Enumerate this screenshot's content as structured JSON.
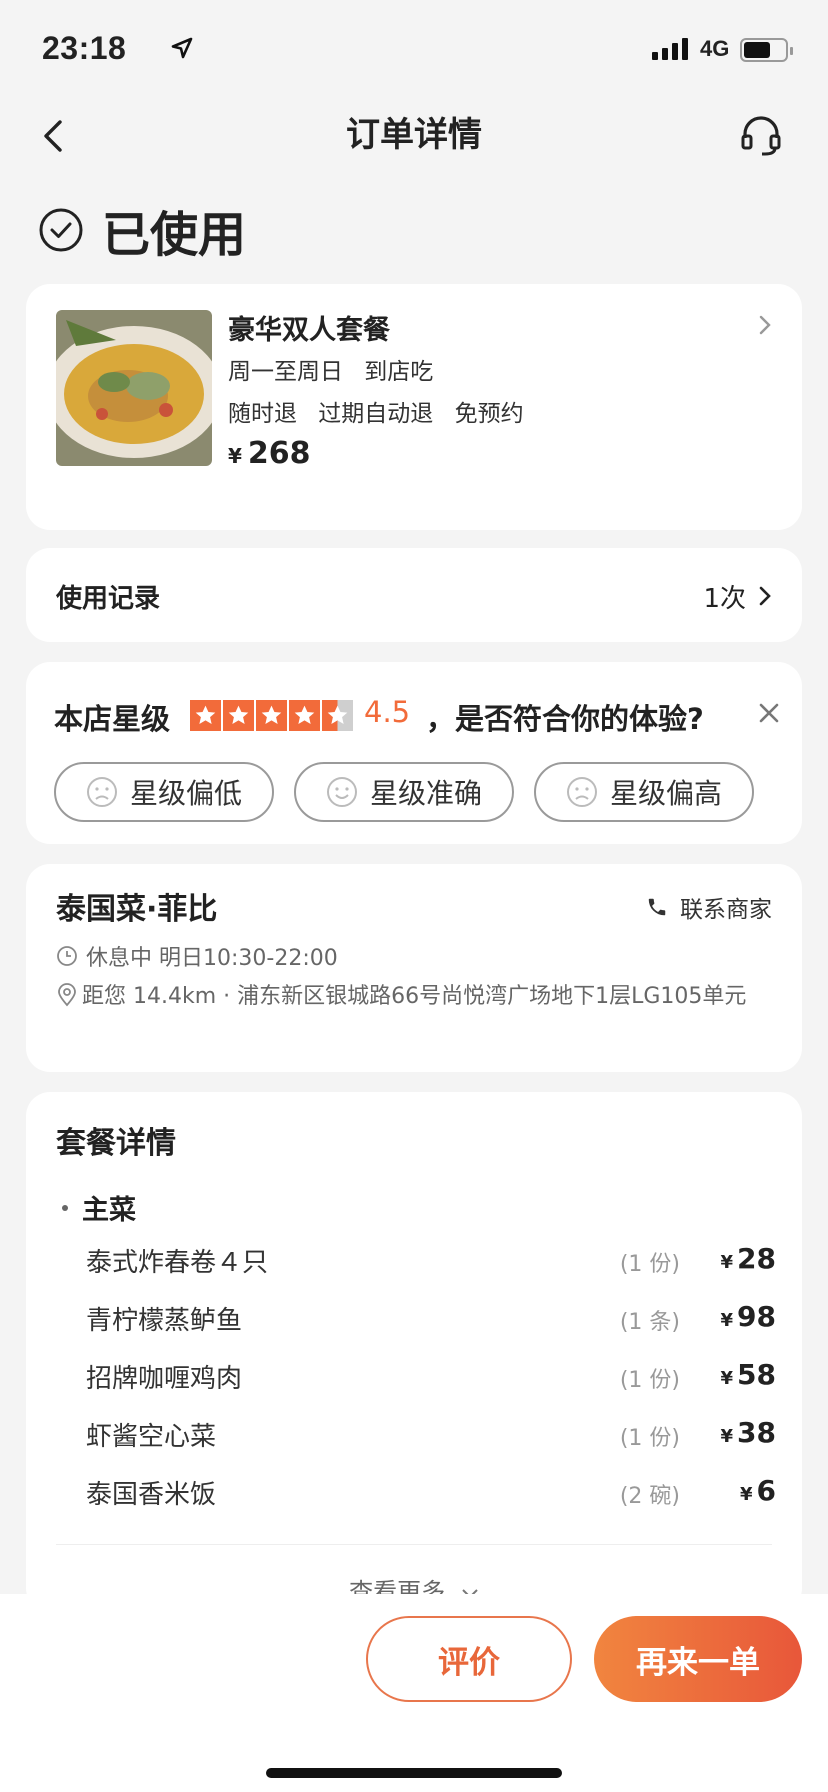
{
  "status_bar": {
    "time": "23:18",
    "network": "4G",
    "battery_level": 0.65
  },
  "nav": {
    "title": "订单详情",
    "back_icon": "chevron-left-icon",
    "service_icon": "headset-icon"
  },
  "order_state": {
    "label": "已使用",
    "icon": "check-circle-icon"
  },
  "product": {
    "name": "豪华双人套餐",
    "schedule": "周一至周日 到店吃",
    "policies": "随时退 过期自动退 免预约",
    "currency": "¥",
    "price": "268"
  },
  "usage_record": {
    "label": "使用记录",
    "count": "1次"
  },
  "rating": {
    "label": "本店星级",
    "stars": 4.5,
    "score": "4.5",
    "question": "，是否符合你的体验?",
    "options": [
      "星级偏低",
      "星级准确",
      "星级偏高"
    ],
    "accent": "#f26b3a"
  },
  "shop": {
    "name": "泰国菜·菲比",
    "contact_label": "联系商家",
    "hours": "休息中 明日10:30-22:00",
    "address": "距您 14.4km · 浦东新区银城路66号尚悦湾广场地下1层LG105单元"
  },
  "package": {
    "title": "套餐详情",
    "section": "主菜",
    "items": [
      {
        "name": "泰式炸春卷４只",
        "qty": "(1 份)",
        "price": "28"
      },
      {
        "name": "青柠檬蒸鲈鱼",
        "qty": "(1 条)",
        "price": "98"
      },
      {
        "name": "招牌咖喱鸡肉",
        "qty": "(1 份)",
        "price": "58"
      },
      {
        "name": "虾酱空心菜",
        "qty": "(1 份)",
        "price": "38"
      },
      {
        "name": "泰国香米饭",
        "qty": "(2 碗)",
        "price": "6"
      }
    ],
    "currency": "¥",
    "more_label": "查看更多"
  },
  "actions": {
    "review": "评价",
    "reorder": "再来一单"
  }
}
